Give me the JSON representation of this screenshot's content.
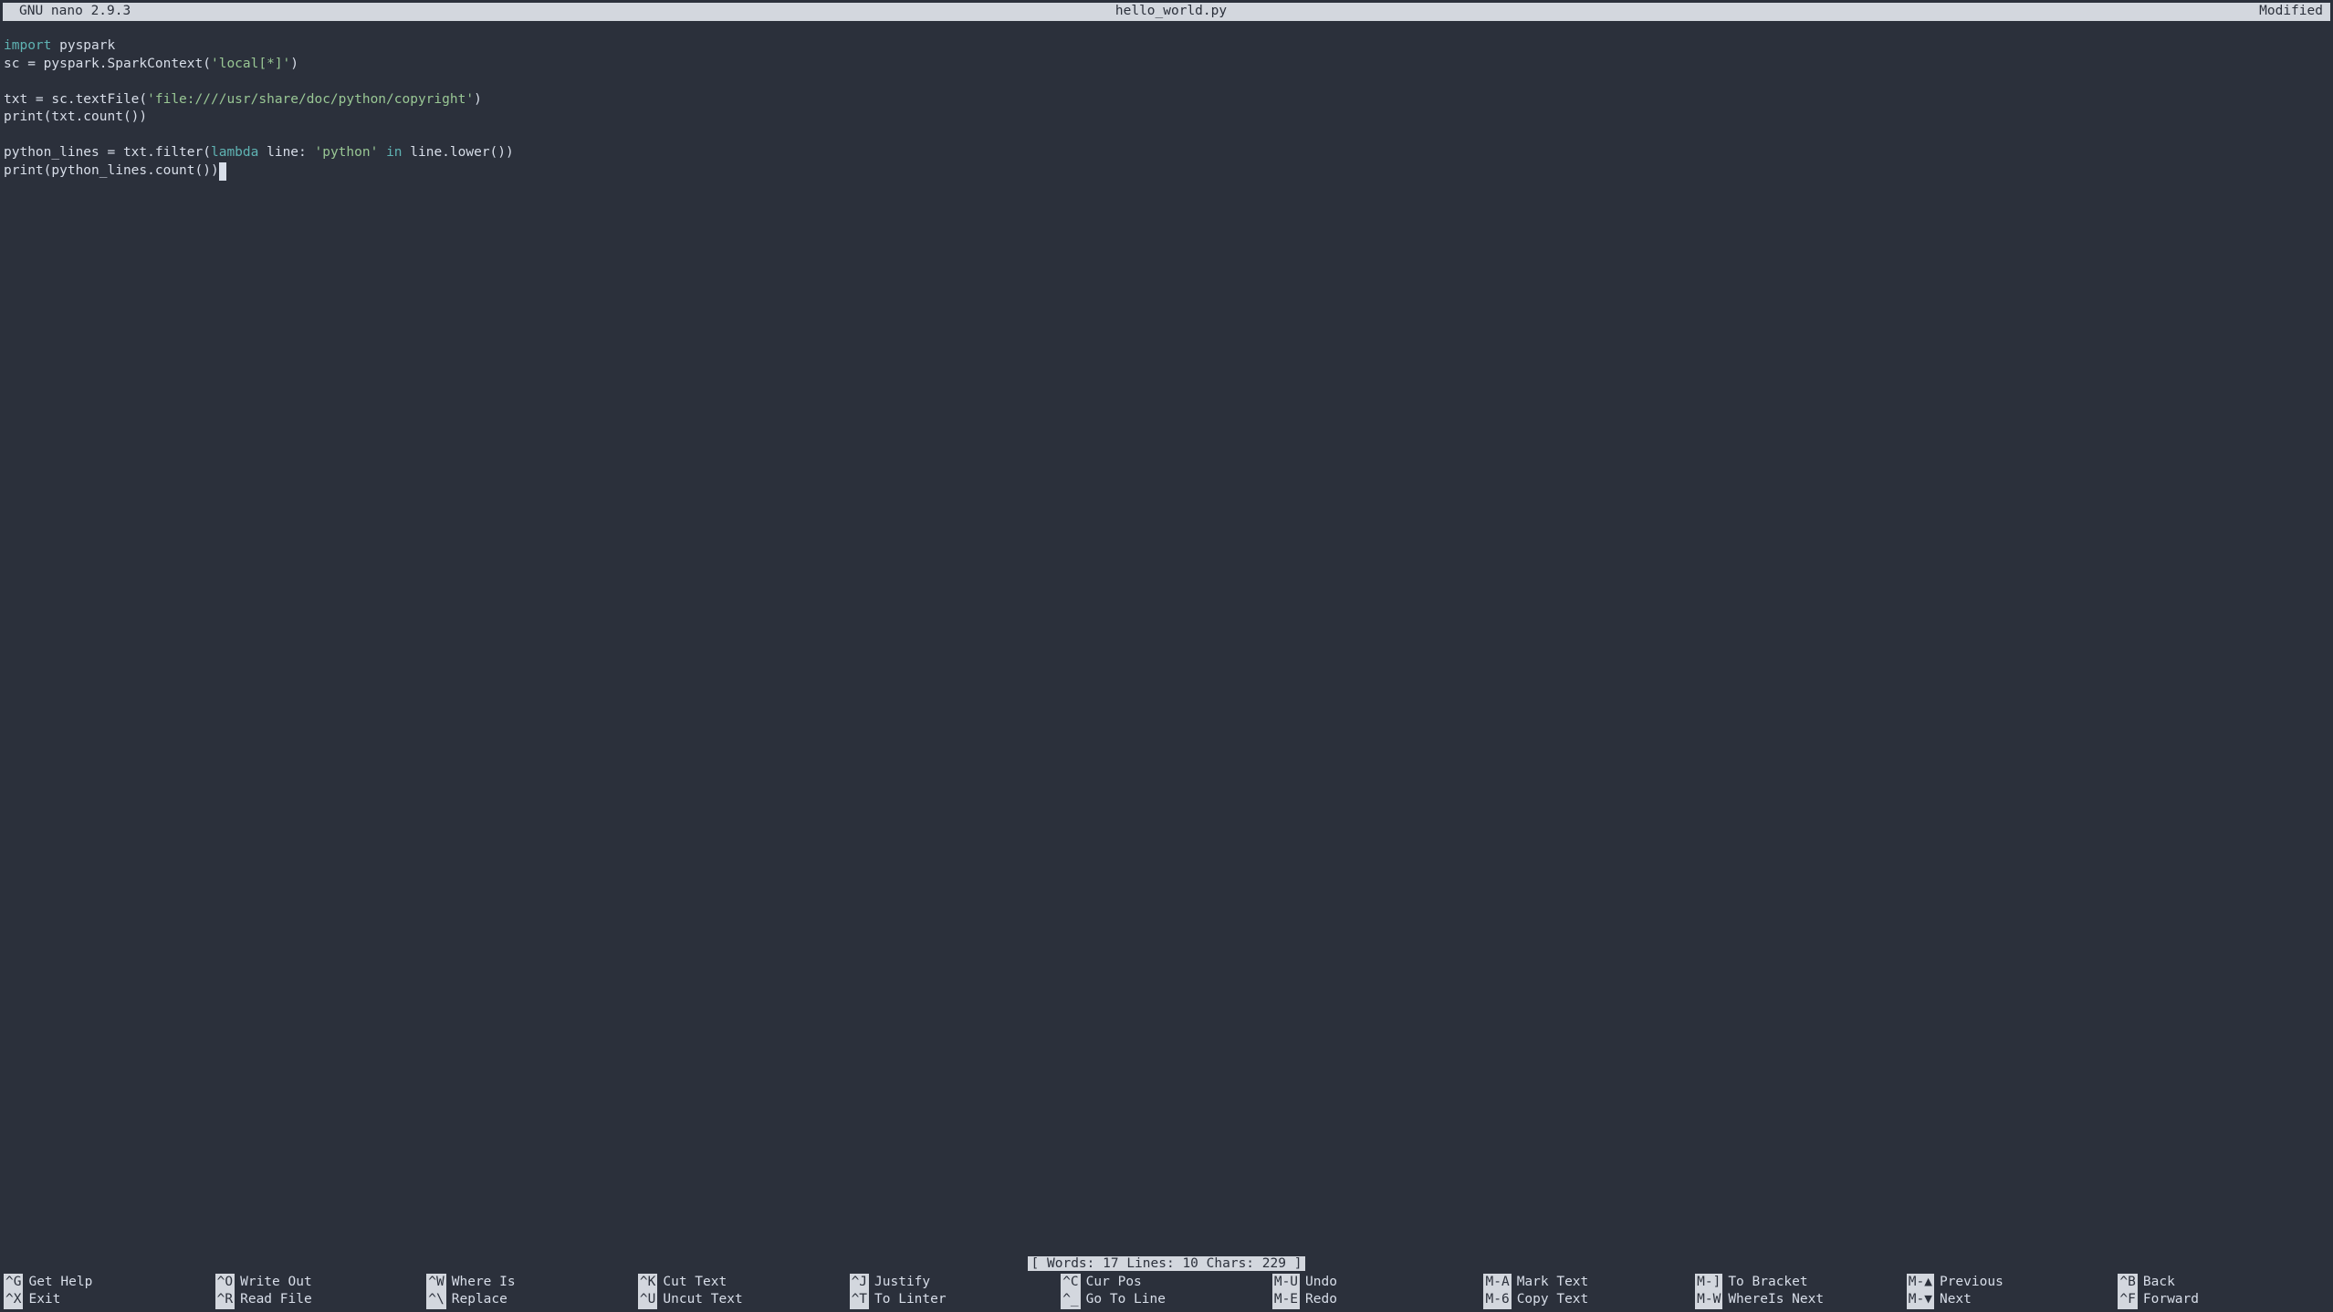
{
  "titlebar": {
    "app": "GNU nano 2.9.3",
    "filename": "hello_world.py",
    "status": "Modified"
  },
  "code": {
    "lines": [
      {
        "tokens": [
          {
            "t": "import",
            "c": "kw"
          },
          {
            "t": " pyspark",
            "c": "normal"
          }
        ]
      },
      {
        "tokens": [
          {
            "t": "sc = pyspark.SparkContext(",
            "c": "normal"
          },
          {
            "t": "'local[*]'",
            "c": "str"
          },
          {
            "t": ")",
            "c": "normal"
          }
        ]
      },
      {
        "tokens": []
      },
      {
        "tokens": [
          {
            "t": "txt = sc.textFile(",
            "c": "normal"
          },
          {
            "t": "'file:////usr/share/doc/python/copyright'",
            "c": "str"
          },
          {
            "t": ")",
            "c": "normal"
          }
        ]
      },
      {
        "tokens": [
          {
            "t": "print(txt.count())",
            "c": "normal"
          }
        ]
      },
      {
        "tokens": []
      },
      {
        "tokens": [
          {
            "t": "python_lines = txt.filter(",
            "c": "normal"
          },
          {
            "t": "lambda",
            "c": "kw"
          },
          {
            "t": " line: ",
            "c": "normal"
          },
          {
            "t": "'python'",
            "c": "str"
          },
          {
            "t": " ",
            "c": "normal"
          },
          {
            "t": "in",
            "c": "kw"
          },
          {
            "t": " line.lower())",
            "c": "normal"
          }
        ]
      },
      {
        "tokens": [
          {
            "t": "print(python_lines.count())",
            "c": "normal"
          }
        ],
        "cursor": true
      }
    ]
  },
  "status": {
    "words_label": "Words:",
    "words": "17",
    "lines_label": "Lines:",
    "lines": "10",
    "chars_label": "Chars:",
    "chars": "229"
  },
  "shortcuts": {
    "row1": [
      {
        "key": "^G",
        "label": "Get Help"
      },
      {
        "key": "^O",
        "label": "Write Out"
      },
      {
        "key": "^W",
        "label": "Where Is"
      },
      {
        "key": "^K",
        "label": "Cut Text"
      },
      {
        "key": "^J",
        "label": "Justify"
      },
      {
        "key": "^C",
        "label": "Cur Pos"
      },
      {
        "key": "M-U",
        "label": "Undo"
      },
      {
        "key": "M-A",
        "label": "Mark Text"
      },
      {
        "key": "M-]",
        "label": "To Bracket"
      },
      {
        "key": "M-▲",
        "label": "Previous"
      },
      {
        "key": "^B",
        "label": "Back"
      }
    ],
    "row2": [
      {
        "key": "^X",
        "label": "Exit"
      },
      {
        "key": "^R",
        "label": "Read File"
      },
      {
        "key": "^\\",
        "label": "Replace"
      },
      {
        "key": "^U",
        "label": "Uncut Text"
      },
      {
        "key": "^T",
        "label": "To Linter"
      },
      {
        "key": "^_",
        "label": "Go To Line"
      },
      {
        "key": "M-E",
        "label": "Redo"
      },
      {
        "key": "M-6",
        "label": "Copy Text"
      },
      {
        "key": "M-W",
        "label": "WhereIs Next"
      },
      {
        "key": "M-▼",
        "label": "Next"
      },
      {
        "key": "^F",
        "label": "Forward"
      }
    ]
  }
}
